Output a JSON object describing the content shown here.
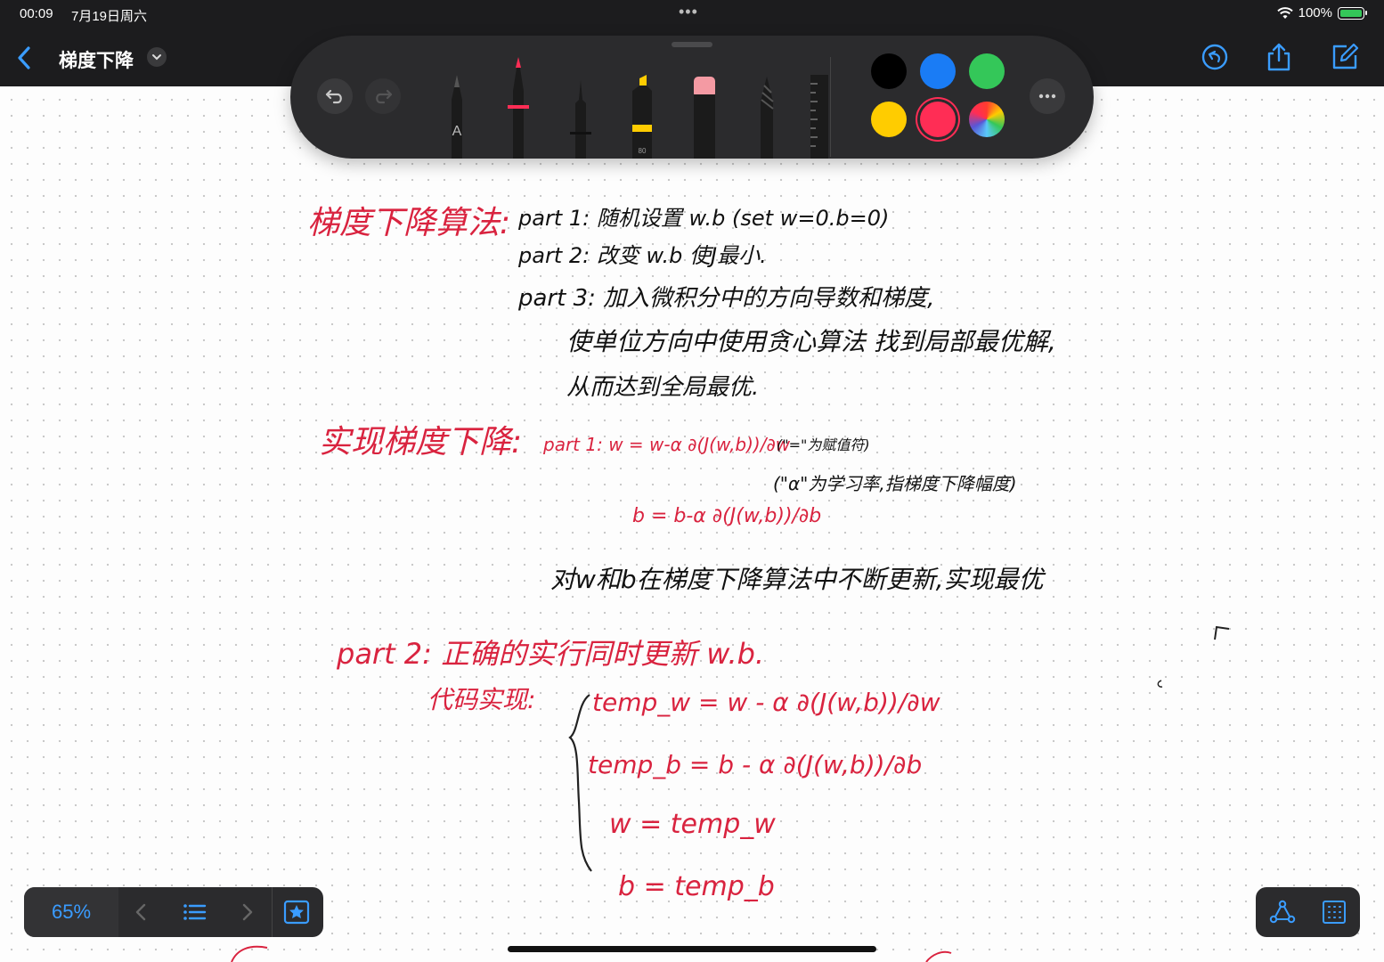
{
  "status_bar": {
    "time": "00:09",
    "date": "7月19日周六",
    "battery": "100%"
  },
  "header": {
    "title": "梯度下降"
  },
  "toolbar": {
    "pencil_letter": "A",
    "marker_number": "80",
    "colors": [
      "#000000",
      "#1a7cf5",
      "#34c759",
      "#ffcc00",
      "#ff2d55"
    ]
  },
  "notes": {
    "heading1": "梯度下降算法:",
    "line1": "part 1: 随机设置 w.b (set w=0.b=0)",
    "line2": "part 2: 改变 w.b 使J最小.",
    "line3": "part 3: 加入微积分中的方向导数和梯度,",
    "line4": "使单位方向中使用贪心算法 找到局部最优解,",
    "line5": "从而达到全局最优.",
    "heading2": "实现梯度下降:",
    "formula_w": "part 1:  w = w-α ∂(J(w,b))/∂w",
    "note_assign": "(\"=\"为赋值符)",
    "note_alpha": "(\"α\"为学习率,指梯度下降幅度)",
    "formula_b": "b = b-α ∂(J(w,b))/∂b",
    "summary": "对w和b在梯度下降算法中不断更新,实现最优",
    "heading3": "part 2: 正确的实行同时更新 w.b.",
    "code_label": "代码实现:",
    "code1": "temp_w = w - α ∂(J(w,b))/∂w",
    "code2": "temp_b = b - α ∂(J(w,b))/∂b",
    "code3": "w = temp_w",
    "code4": "b = temp_b"
  },
  "bottom_bar": {
    "zoom": "65%"
  }
}
